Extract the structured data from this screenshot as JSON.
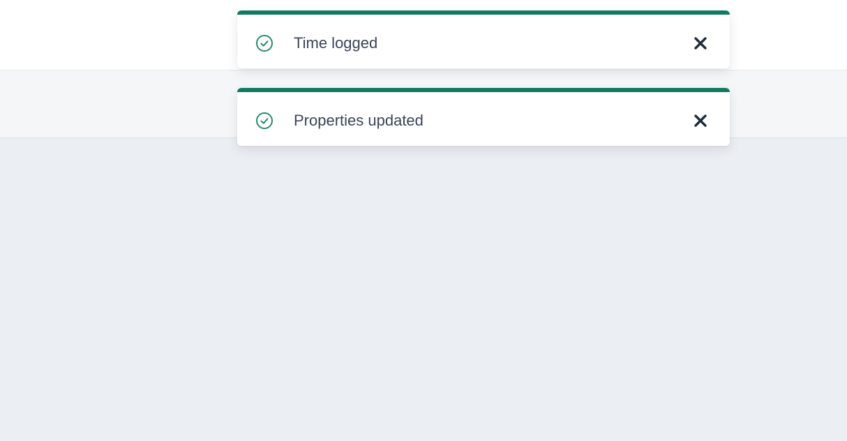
{
  "toasts": [
    {
      "message": "Time logged",
      "icon": "check-circle-icon",
      "close_icon": "close-icon"
    },
    {
      "message": "Properties updated",
      "icon": "check-circle-icon",
      "close_icon": "close-icon"
    }
  ],
  "colors": {
    "success_accent": "#0f7a5f",
    "text": "#3a4556",
    "close": "#1c2a3a"
  }
}
